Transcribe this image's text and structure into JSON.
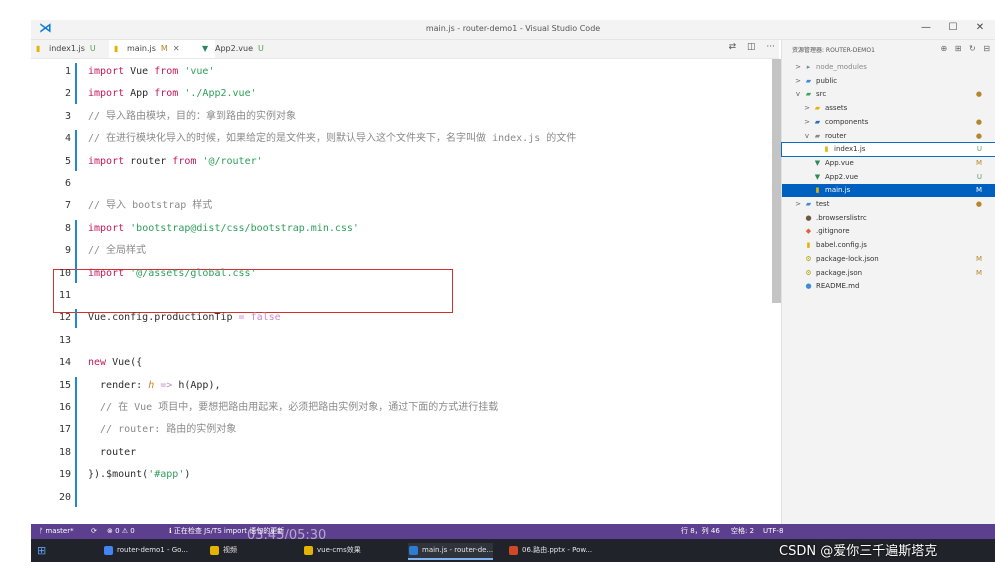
{
  "window": {
    "title": "main.js - router-demo1 - Visual Studio Code",
    "controls": [
      "—",
      "☐",
      "✕"
    ]
  },
  "tabs": [
    {
      "label": "index1.js",
      "status": "U",
      "icon_color": "#e5b400",
      "active": false
    },
    {
      "label": "main.js",
      "status": "M",
      "icon_color": "#e5b400",
      "active": true,
      "close": "✕"
    },
    {
      "label": "App2.vue",
      "status": "U",
      "icon_color": "#2b8a5a",
      "active": false
    }
  ],
  "editor_actions": [
    "⇄",
    "◫",
    "···"
  ],
  "code_lines": [
    {
      "n": "1",
      "tokens": [
        [
          "kw",
          "import"
        ],
        [
          "t",
          " Vue "
        ],
        [
          "kw",
          "from"
        ],
        [
          "t",
          " "
        ],
        [
          "str",
          "'vue'"
        ]
      ]
    },
    {
      "n": "2",
      "tokens": [
        [
          "kw",
          "import"
        ],
        [
          "t",
          " App "
        ],
        [
          "kw",
          "from"
        ],
        [
          "t",
          " "
        ],
        [
          "str",
          "'./App2.vue'"
        ]
      ]
    },
    {
      "n": "3",
      "tokens": [
        [
          "cm",
          "// 导入路由模块，目的：拿到路由的实例对象"
        ]
      ]
    },
    {
      "n": "4",
      "tokens": [
        [
          "cm",
          "// 在进行模块化导入的时候，如果给定的是文件夹，则默认导入这个文件夹下，名字叫做 index.js 的文件"
        ]
      ]
    },
    {
      "n": "5",
      "tokens": [
        [
          "kw",
          "import"
        ],
        [
          "t",
          " router "
        ],
        [
          "kw",
          "from"
        ],
        [
          "t",
          " "
        ],
        [
          "str",
          "'@/router'"
        ]
      ]
    },
    {
      "n": "6",
      "tokens": []
    },
    {
      "n": "7",
      "tokens": [
        [
          "cm",
          "// 导入 bootstrap 样式"
        ]
      ]
    },
    {
      "n": "8",
      "tokens": [
        [
          "kw",
          "import"
        ],
        [
          "t",
          " "
        ],
        [
          "str",
          "'bootstrap@dist/css/bootstrap.min.css'"
        ]
      ]
    },
    {
      "n": "9",
      "tokens": [
        [
          "cm",
          "// 全局样式"
        ]
      ]
    },
    {
      "n": "10",
      "tokens": [
        [
          "kw",
          "import"
        ],
        [
          "t",
          " "
        ],
        [
          "str",
          "'@/assets/global.css'"
        ]
      ]
    },
    {
      "n": "11",
      "tokens": []
    },
    {
      "n": "12",
      "tokens": [
        [
          "t",
          "Vue.config.productionTip "
        ],
        [
          "arrow",
          "="
        ],
        [
          "t",
          " "
        ],
        [
          "bool",
          "false"
        ]
      ]
    },
    {
      "n": "13",
      "tokens": []
    },
    {
      "n": "14",
      "tokens": [
        [
          "kw",
          "new"
        ],
        [
          "t",
          " Vue({"
        ]
      ]
    },
    {
      "n": "15",
      "tokens": [
        [
          "t",
          "  render: "
        ],
        [
          "param",
          "h"
        ],
        [
          "t",
          " "
        ],
        [
          "arrow",
          "=>"
        ],
        [
          "t",
          " h(App),"
        ]
      ]
    },
    {
      "n": "16",
      "tokens": [
        [
          "cm",
          "  // 在 Vue 项目中，要想把路由用起来，必须把路由实例对象，通过下面的方式进行挂载"
        ]
      ]
    },
    {
      "n": "17",
      "tokens": [
        [
          "cm",
          "  // router: 路由的实例对象"
        ]
      ]
    },
    {
      "n": "18",
      "tokens": [
        [
          "t",
          "  router"
        ]
      ]
    },
    {
      "n": "19",
      "tokens": [
        [
          "t",
          "}).$mount("
        ],
        [
          "str",
          "'#app'"
        ],
        [
          "t",
          ")"
        ]
      ]
    },
    {
      "n": "20",
      "tokens": []
    }
  ],
  "explorer": {
    "header": "资源管理器: ROUTER-DEMO1",
    "tools": [
      "⊕",
      "⊞",
      "↻",
      "⊟"
    ],
    "items": [
      {
        "label": "node_modules",
        "depth": 0,
        "chev": ">",
        "icon": "▸",
        "icon_color": "#7a8a99",
        "status": "",
        "dim": true
      },
      {
        "label": "public",
        "depth": 0,
        "chev": ">",
        "icon": "▰",
        "icon_color": "#3c8dd9",
        "status": ""
      },
      {
        "label": "src",
        "depth": 0,
        "chev": "v",
        "icon": "▰",
        "icon_color": "#3fa35a",
        "status": "●"
      },
      {
        "label": "assets",
        "depth": 1,
        "chev": ">",
        "icon": "▰",
        "icon_color": "#e5b400",
        "status": ""
      },
      {
        "label": "components",
        "depth": 1,
        "chev": ">",
        "icon": "▰",
        "icon_color": "#2f6fb5",
        "status": "●"
      },
      {
        "label": "router",
        "depth": 1,
        "chev": "v",
        "icon": "▰",
        "icon_color": "#888888",
        "status": "●"
      },
      {
        "label": "index1.js",
        "depth": 2,
        "chev": "",
        "icon": "▮",
        "icon_color": "#e5b400",
        "status": "U",
        "focus": true
      },
      {
        "label": "App.vue",
        "depth": 1,
        "chev": "",
        "icon": "▼",
        "icon_color": "#2b8a5a",
        "status": "M"
      },
      {
        "label": "App2.vue",
        "depth": 1,
        "chev": "",
        "icon": "▼",
        "icon_color": "#2b8a5a",
        "status": "U"
      },
      {
        "label": "main.js",
        "depth": 1,
        "chev": "",
        "icon": "▮",
        "icon_color": "#e5b400",
        "status": "M",
        "selected": true
      },
      {
        "label": "test",
        "depth": 0,
        "chev": ">",
        "icon": "▰",
        "icon_color": "#3c8dd9",
        "status": "●"
      },
      {
        "label": ".browserslistrc",
        "depth": 0,
        "chev": "",
        "icon": "●",
        "icon_color": "#6b5b3b",
        "status": ""
      },
      {
        "label": ".gitignore",
        "depth": 0,
        "chev": "",
        "icon": "◆",
        "icon_color": "#e0603a",
        "status": ""
      },
      {
        "label": "babel.config.js",
        "depth": 0,
        "chev": "",
        "icon": "▮",
        "icon_color": "#e5b400",
        "status": ""
      },
      {
        "label": "package-lock.json",
        "depth": 0,
        "chev": "",
        "icon": "⚙",
        "icon_color": "#b0a000",
        "status": "M"
      },
      {
        "label": "package.json",
        "depth": 0,
        "chev": "",
        "icon": "⚙",
        "icon_color": "#b0a000",
        "status": "M"
      },
      {
        "label": "README.md",
        "depth": 0,
        "chev": "",
        "icon": "●",
        "icon_color": "#3c8dd9",
        "status": ""
      }
    ]
  },
  "statusbar": {
    "branch": "ᚠ master*",
    "sync": "⟳",
    "problems": "⊗ 0 ⚠ 0",
    "info": "ℹ 正在检查 JS/TS import 语句的更新",
    "position": "行 8，列 46",
    "spaces": "空格: 2",
    "encoding": "UTF-8"
  },
  "taskbar": {
    "start": "⊞",
    "items": [
      {
        "label": "router-demo1 - Go...",
        "color": "#4285f4"
      },
      {
        "label": "视频",
        "color": "#e5b400"
      },
      {
        "label": "vue-cms效果",
        "color": "#e5b400"
      },
      {
        "label": "main.js - router-de...",
        "color": "#2b7cd3",
        "active": true
      },
      {
        "label": "06.路由.pptx - Pow...",
        "color": "#d24726"
      }
    ]
  },
  "overlays": {
    "watermark": "CSDN @爱你三千遍斯塔克",
    "video_timestamp": "03:45/05:30"
  }
}
